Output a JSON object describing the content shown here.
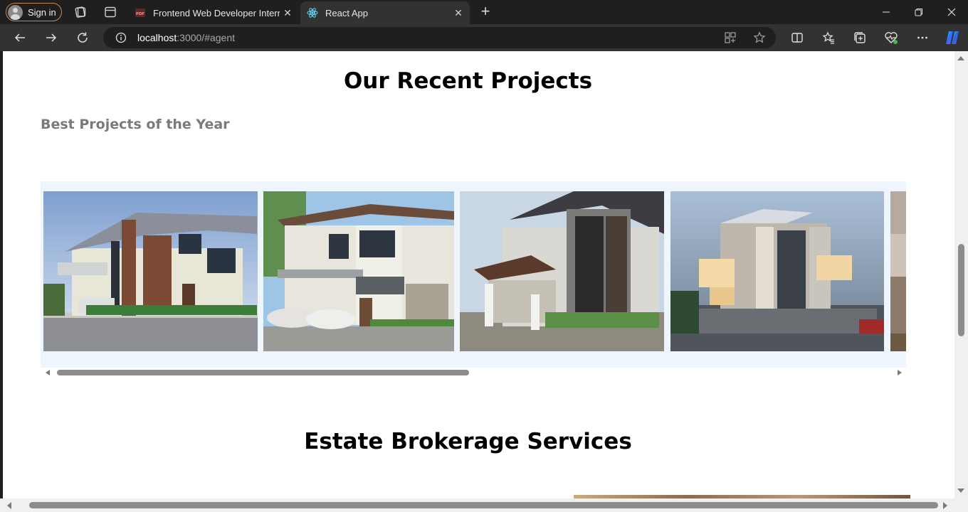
{
  "browser": {
    "signin_label": "Sign in",
    "tabs": [
      {
        "title": "Frontend Web Developer Internship",
        "icon": "pdf-icon",
        "active": false
      },
      {
        "title": "React App",
        "icon": "react-icon",
        "active": true
      }
    ],
    "url_host": "localhost",
    "url_rest": ":3000/#agent"
  },
  "page": {
    "projects_title": "Our Recent Projects",
    "projects_subtitle": "Best Projects of the Year",
    "projects": [
      {
        "name": "project-house-1"
      },
      {
        "name": "project-house-2"
      },
      {
        "name": "project-house-3"
      },
      {
        "name": "project-house-4"
      },
      {
        "name": "project-house-5"
      }
    ],
    "services_title": "Estate Brokerage Services"
  },
  "colors": {
    "browser_dark": "#1f1f1f",
    "toolbar": "#323232",
    "carousel_bg": "#eef5fd",
    "subtitle": "#7a7a7a"
  }
}
